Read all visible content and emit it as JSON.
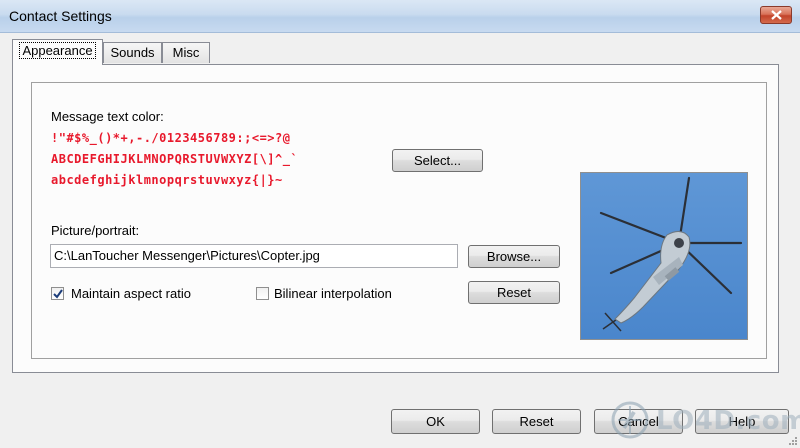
{
  "window": {
    "title": "Contact Settings"
  },
  "tabs": [
    {
      "label": "Appearance",
      "active": true
    },
    {
      "label": "Sounds",
      "active": false
    },
    {
      "label": "Misc",
      "active": false
    }
  ],
  "appearance": {
    "message_color_label": "Message text color:",
    "text_color": "#e8192c",
    "preview_lines": [
      "!\"#$%_()*+,-./0123456789:;<=>?@",
      "ABCDEFGHIJKLMNOPQRSTUVWXYZ[\\]^_`",
      "abcdefghijklmnopqrstuvwxyz{|}~"
    ],
    "select_button": "Select...",
    "picture_label": "Picture/portrait:",
    "picture_path": "C:\\LanToucher Messenger\\Pictures\\Copter.jpg",
    "browse_button": "Browse...",
    "reset_picture_button": "Reset",
    "maintain_aspect": {
      "label": "Maintain aspect ratio",
      "checked": true
    },
    "bilinear": {
      "label": "Bilinear interpolation",
      "checked": false
    },
    "picture_icon": "helicopter-photo"
  },
  "footer": {
    "ok": "OK",
    "reset": "Reset",
    "cancel": "Cancel",
    "help": "Help"
  },
  "watermark": "LO4D.com"
}
